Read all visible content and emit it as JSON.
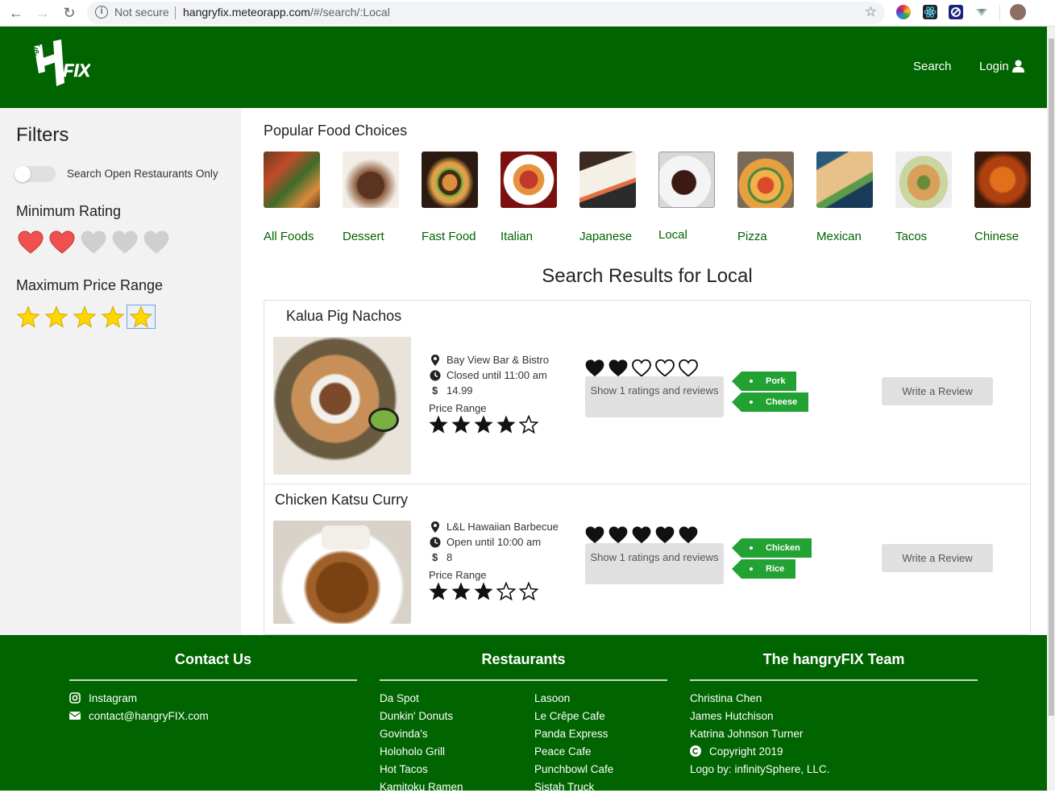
{
  "browser": {
    "security": "Not secure",
    "url_host": "hangryfix.meteorapp.com",
    "url_path": "/#/search/:Local"
  },
  "header": {
    "logo_text": "hangry FIX",
    "nav_search": "Search",
    "nav_login": "Login"
  },
  "filters": {
    "title": "Filters",
    "open_only_label": "Search Open Restaurants Only",
    "open_only": false,
    "min_rating_title": "Minimum Rating",
    "min_rating": 2,
    "min_rating_max": 5,
    "max_price_title": "Maximum Price Range",
    "max_price": 5,
    "max_price_max": 5
  },
  "popular": {
    "title": "Popular Food Choices",
    "items": [
      {
        "label": "All Foods"
      },
      {
        "label": "Dessert"
      },
      {
        "label": "Fast Food"
      },
      {
        "label": "Italian"
      },
      {
        "label": "Japanese"
      },
      {
        "label": "Local"
      },
      {
        "label": "Pizza"
      },
      {
        "label": "Mexican"
      },
      {
        "label": "Tacos"
      },
      {
        "label": "Chinese"
      }
    ]
  },
  "results": {
    "title": "Search Results for Local",
    "items": [
      {
        "name": "Kalua Pig Nachos",
        "restaurant": "Bay View Bar & Bistro",
        "hours": "Closed until 11:00 am",
        "price_symbol": "$",
        "price": "14.99",
        "price_range_label": "Price Range",
        "price_range": 4,
        "rating": 2,
        "show_reviews": "Show 1 ratings and reviews",
        "tags": [
          "Pork",
          "Cheese"
        ],
        "write_review": "Write a Review"
      },
      {
        "name": "Chicken Katsu Curry",
        "restaurant": "L&L Hawaiian Barbecue",
        "hours": "Open until 10:00 am",
        "price_symbol": "$",
        "price": "8",
        "price_range_label": "Price Range",
        "price_range": 3,
        "rating": 5,
        "show_reviews": "Show 1 ratings and reviews",
        "tags": [
          "Chicken",
          "Rice"
        ],
        "write_review": "Write a Review"
      }
    ]
  },
  "footer": {
    "contact": {
      "title": "Contact Us",
      "instagram": "Instagram",
      "email": "contact@hangryFIX.com"
    },
    "restaurants": {
      "title": "Restaurants",
      "col1": [
        "Da Spot",
        "Dunkin' Donuts",
        "Govinda's",
        "Holoholo Grill",
        "Hot Tacos",
        "Kamitoku Ramen"
      ],
      "col2": [
        "Lasoon",
        "Le Crêpe Cafe",
        "Panda Express",
        "Peace Cafe",
        "Punchbowl Cafe",
        "Sistah Truck"
      ]
    },
    "team": {
      "title": "The hangryFIX Team",
      "members": [
        "Christina Chen",
        "James Hutchison",
        "Katrina Johnson Turner"
      ],
      "copyright": "Copyright 2019",
      "logo_credit": "Logo by: infinitySphere, LLC."
    }
  },
  "colors": {
    "brand_green": "#006400",
    "tag_green": "#21a232",
    "heart_red": "#f05050",
    "star_yellow": "#ffd600"
  }
}
